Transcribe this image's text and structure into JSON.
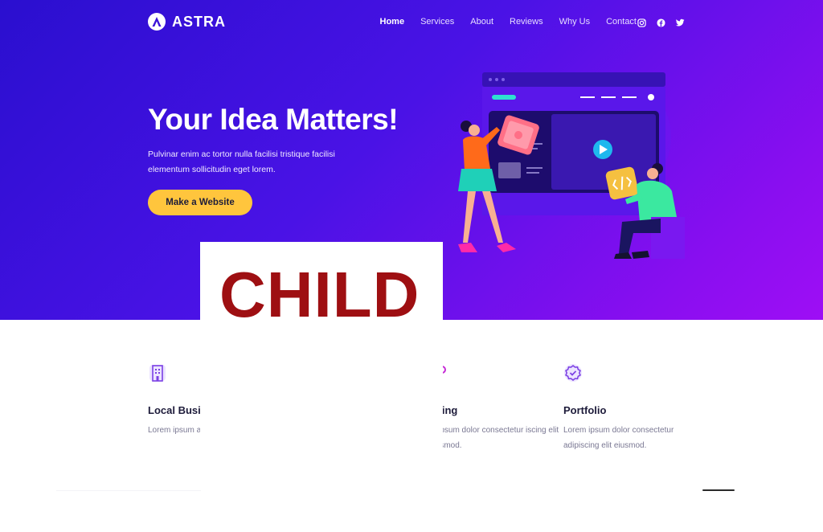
{
  "brand": {
    "name": "ASTRA"
  },
  "nav": {
    "items": [
      {
        "label": "Home",
        "active": true
      },
      {
        "label": "Services",
        "active": false
      },
      {
        "label": "About",
        "active": false
      },
      {
        "label": "Reviews",
        "active": false
      },
      {
        "label": "Why Us",
        "active": false
      },
      {
        "label": "Contact",
        "active": false
      }
    ]
  },
  "social": [
    "instagram-icon",
    "facebook-icon",
    "twitter-icon"
  ],
  "hero": {
    "title": "Your Idea Matters!",
    "subtitle": "Pulvinar enim ac tortor nulla facilisi tristique facilisi elementum sollicitudin eget lorem.",
    "cta_label": "Make a Website"
  },
  "features": [
    {
      "icon": "building-icon",
      "title": "Local Busi",
      "text": "Lorem ipsum adipiscing elit"
    },
    {
      "icon": "blog-icon",
      "title": "gging",
      "text": "m ipsum dolor consectetur iscing elit eiusmod."
    },
    {
      "icon": "badge-check-icon",
      "title": "Portfolio",
      "text": "Lorem ipsum dolor consectetur adipiscing elit eiusmod."
    }
  ],
  "overlay": {
    "label": "CHILD"
  },
  "colors": {
    "hero_start": "#2a0fcf",
    "hero_end": "#9e0ef5",
    "cta": "#ffc53d",
    "overlay_text": "#9e0f12",
    "feature_icon": "#7b3fe4"
  }
}
